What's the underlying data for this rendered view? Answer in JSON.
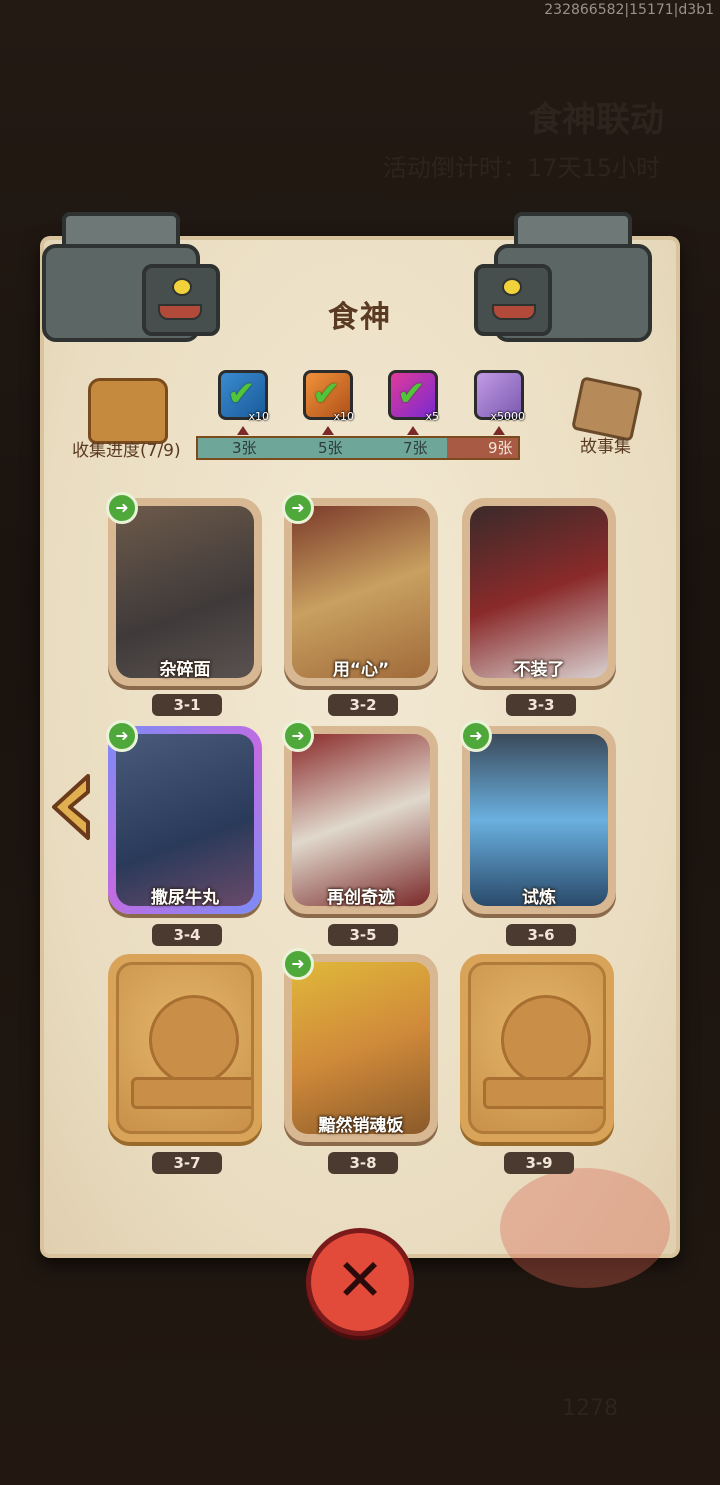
{
  "build_id": "232866582|15171|d3b1",
  "background": {
    "event_title": "食神联动",
    "timer": "活动倒计时：17天15小时",
    "currency_count": "1278"
  },
  "panel": {
    "title": "食神",
    "progress_label": "收集进度(7/9)",
    "story_label": "故事集",
    "progress": {
      "collected": 7,
      "total": 9
    },
    "milestones": [
      {
        "label": "3张",
        "qty": "x10",
        "claimed": true,
        "icon": "chest-green-icon"
      },
      {
        "label": "5张",
        "qty": "x10",
        "claimed": true,
        "icon": "chest-orange-icon"
      },
      {
        "label": "7张",
        "qty": "x5",
        "claimed": true,
        "icon": "orb-purple-icon"
      },
      {
        "label": "9张",
        "qty": "x5000",
        "claimed": false,
        "icon": "crystal-icon"
      }
    ]
  },
  "cards": [
    {
      "id": "3-1",
      "caption": "杂碎面",
      "unlocked": true
    },
    {
      "id": "3-2",
      "caption": "用“心”",
      "unlocked": true
    },
    {
      "id": "3-3",
      "caption": "不装了",
      "unlocked": true
    },
    {
      "id": "3-4",
      "caption": "撒尿牛丸",
      "unlocked": true
    },
    {
      "id": "3-5",
      "caption": "再创奇迹",
      "unlocked": true
    },
    {
      "id": "3-6",
      "caption": "试炼",
      "unlocked": true
    },
    {
      "id": "3-7",
      "caption": "",
      "unlocked": false
    },
    {
      "id": "3-8",
      "caption": "黯然销魂饭",
      "unlocked": true
    },
    {
      "id": "3-9",
      "caption": "",
      "unlocked": false
    }
  ]
}
